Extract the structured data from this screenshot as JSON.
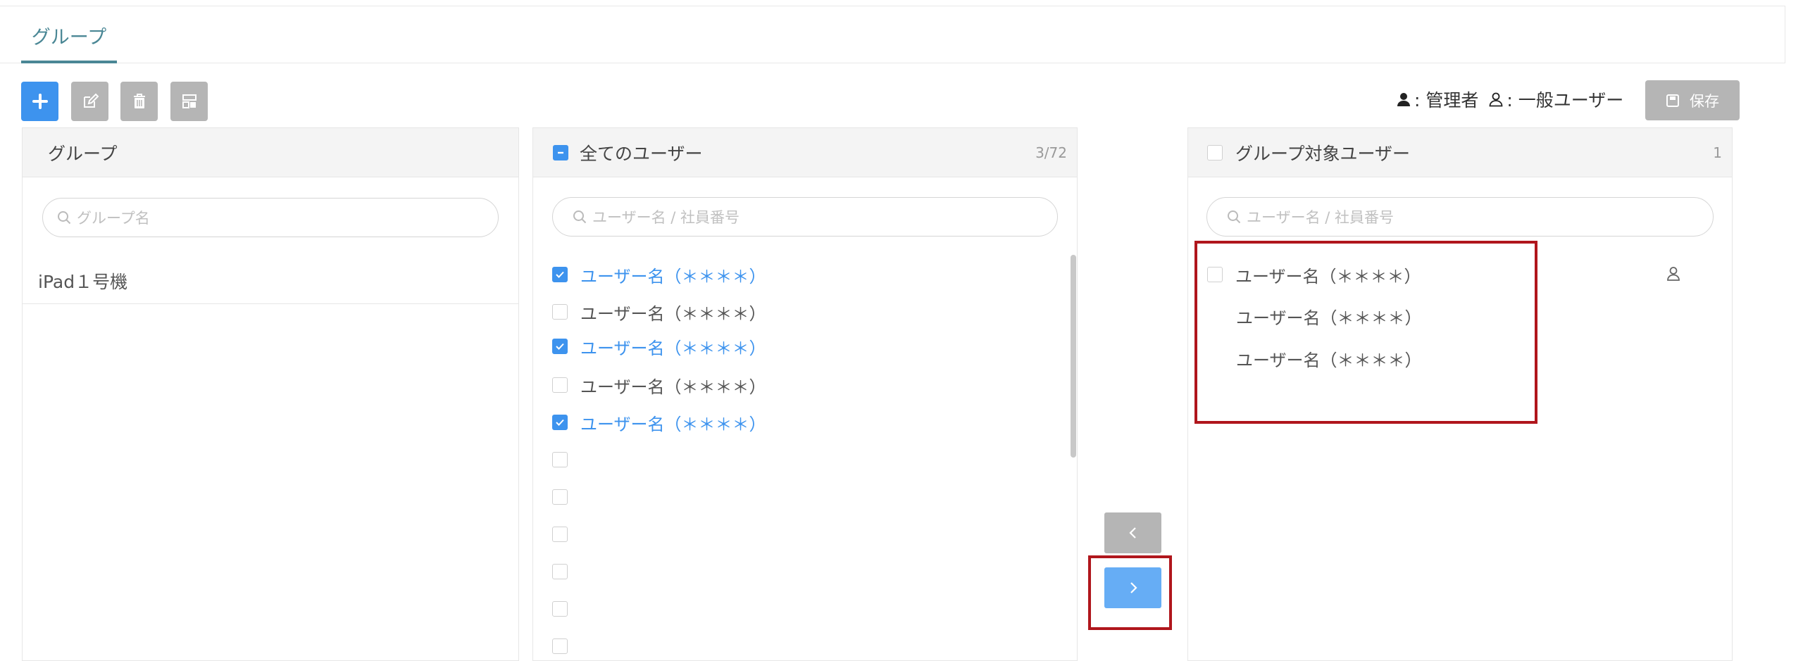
{
  "tabs": [
    {
      "label": "グループ"
    }
  ],
  "legend": {
    "admin": ": 管理者",
    "general": ": 一般ユーザー"
  },
  "toolbar": {
    "save_label": "保存"
  },
  "groups_panel": {
    "title": "グループ",
    "search_placeholder": "グループ名",
    "items": [
      {
        "label": "iPad１号機"
      }
    ]
  },
  "all_users_panel": {
    "title": "全てのユーザー",
    "count": "3/72",
    "search_placeholder": "ユーザー名 / 社員番号",
    "rows": [
      {
        "label": "ユーザー名（＊＊＊＊）",
        "checked": true
      },
      {
        "label": "ユーザー名（＊＊＊＊）",
        "checked": false
      },
      {
        "label": "ユーザー名（＊＊＊＊）",
        "checked": true
      },
      {
        "label": "ユーザー名（＊＊＊＊）",
        "checked": false
      },
      {
        "label": "ユーザー名（＊＊＊＊）",
        "checked": true
      },
      {
        "label": "",
        "checked": false
      },
      {
        "label": "",
        "checked": false
      },
      {
        "label": "",
        "checked": false
      },
      {
        "label": "",
        "checked": false
      },
      {
        "label": "",
        "checked": false
      },
      {
        "label": "",
        "checked": false
      }
    ]
  },
  "target_users_panel": {
    "title": "グループ対象ユーザー",
    "count": "1",
    "search_placeholder": "ユーザー名 / 社員番号",
    "rows": [
      {
        "label": "ユーザー名（＊＊＊＊）",
        "role": "general",
        "checkbox": true
      },
      {
        "label": "ユーザー名（＊＊＊＊）",
        "checkbox": false
      },
      {
        "label": "ユーザー名（＊＊＊＊）",
        "checkbox": false
      }
    ]
  },
  "colors": {
    "accent": "#3d93ee",
    "tab": "#4a8795",
    "highlight": "#b0161c",
    "disabled": "#b5b5b5"
  }
}
